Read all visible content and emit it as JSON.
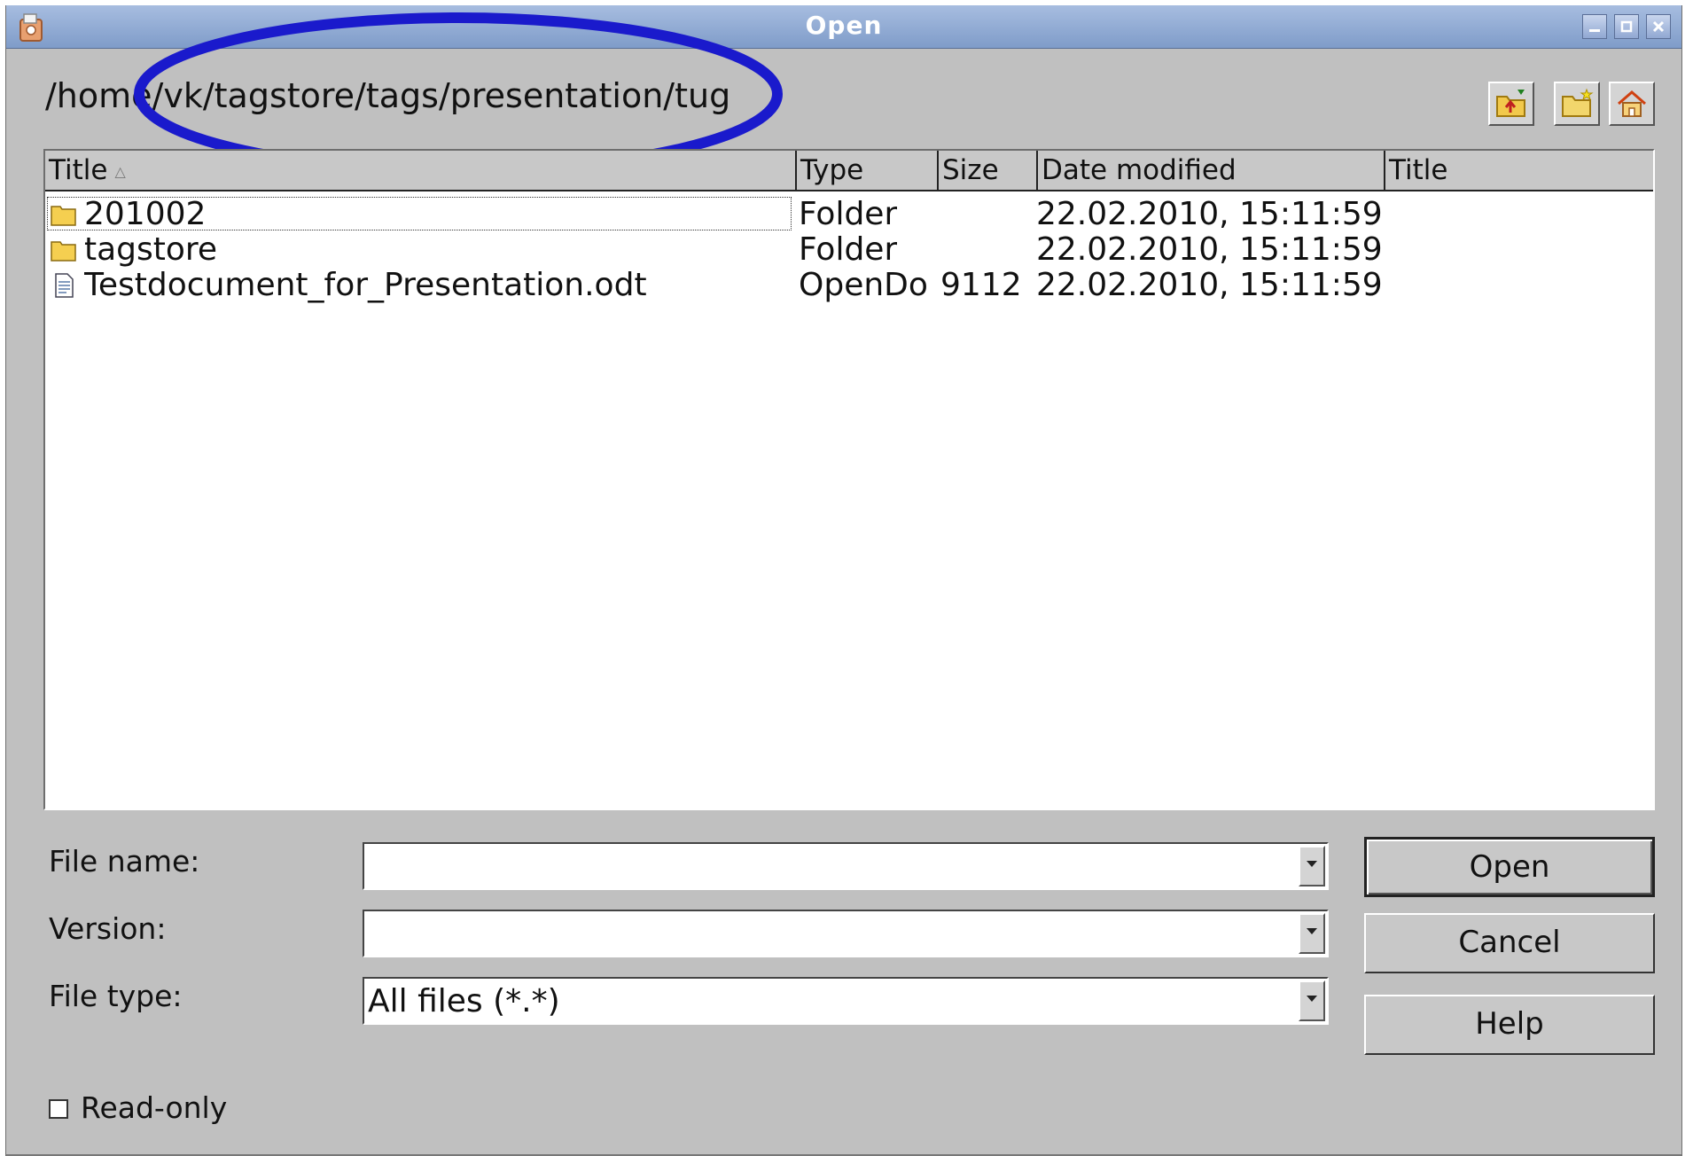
{
  "window": {
    "title": "Open",
    "app_icon": "app-icon",
    "controls": [
      "minimize-icon",
      "maximize-icon",
      "close-icon"
    ]
  },
  "path": "/home/vk/tagstore/tags/presentation/tug",
  "annotation": {
    "shape": "oval",
    "color": "#1a1acc"
  },
  "toolbar": {
    "buttons": [
      {
        "name": "up-one-level",
        "icon": "folder-up-icon"
      },
      {
        "name": "create-new-folder",
        "icon": "new-folder-icon"
      },
      {
        "name": "default-directory",
        "icon": "home-icon"
      }
    ]
  },
  "file_list": {
    "columns": [
      {
        "label": "Title",
        "sort": "ascending"
      },
      {
        "label": "Type"
      },
      {
        "label": "Size"
      },
      {
        "label": "Date modified"
      },
      {
        "label": "Title"
      }
    ],
    "rows": [
      {
        "icon": "folder-icon",
        "title": "201002",
        "type": "Folder",
        "size": "",
        "date": "22.02.2010, 15:11:59",
        "title2": "",
        "selected": true
      },
      {
        "icon": "folder-icon",
        "title": "tagstore",
        "type": "Folder",
        "size": "",
        "date": "22.02.2010, 15:11:59",
        "title2": ""
      },
      {
        "icon": "document-icon",
        "title": "Testdocument_for_Presentation.odt",
        "type": "OpenDo",
        "size": "9112",
        "date": "22.02.2010, 15:11:59",
        "title2": ""
      }
    ]
  },
  "form": {
    "file_name": {
      "label": "File name:",
      "value": ""
    },
    "version": {
      "label": "Version:",
      "value": ""
    },
    "file_type": {
      "label": "File type:",
      "value": "All files (*.*)"
    }
  },
  "buttons": {
    "open": "Open",
    "cancel": "Cancel",
    "help": "Help"
  },
  "read_only": {
    "label": "Read-only",
    "checked": false
  },
  "colors": {
    "titlebar": "#8aa4d0",
    "dialog_bg": "#c0c0c0",
    "annotation": "#1a1acc"
  }
}
